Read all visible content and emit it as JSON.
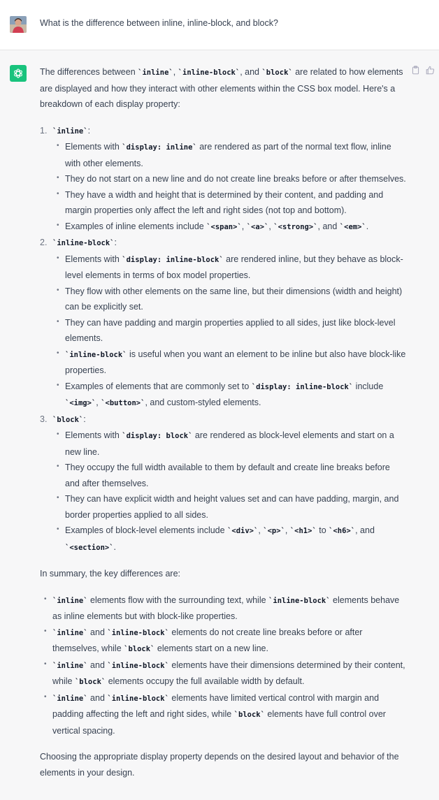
{
  "conversation": {
    "user_message": "What is the difference between inline, inline-block, and block?",
    "assistant": {
      "intro": [
        {
          "t": "The differences between "
        },
        {
          "c": "`inline`"
        },
        {
          "t": ", "
        },
        {
          "c": "`inline-block`"
        },
        {
          "t": ", and "
        },
        {
          "c": "`block`"
        },
        {
          "t": " are related to how elements are displayed and how they interact with other elements within the CSS box model. Here's a breakdown of each display property:"
        }
      ],
      "sections": [
        {
          "num": "1.",
          "heading": "`inline`",
          "heading_suffix": ":",
          "bullets": [
            [
              {
                "t": "Elements with "
              },
              {
                "c": "`display: inline`"
              },
              {
                "t": " are rendered as part of the normal text flow, inline with other elements."
              }
            ],
            [
              {
                "t": "They do not start on a new line and do not create line breaks before or after themselves."
              }
            ],
            [
              {
                "t": "They have a width and height that is determined by their content, and padding and margin properties only affect the left and right sides (not top and bottom)."
              }
            ],
            [
              {
                "t": "Examples of inline elements include "
              },
              {
                "c": "`<span>`"
              },
              {
                "t": ", "
              },
              {
                "c": "`<a>`"
              },
              {
                "t": ", "
              },
              {
                "c": "`<strong>`"
              },
              {
                "t": ", and "
              },
              {
                "c": "`<em>`"
              },
              {
                "t": "."
              }
            ]
          ]
        },
        {
          "num": "2.",
          "heading": "`inline-block`",
          "heading_suffix": ":",
          "bullets": [
            [
              {
                "t": "Elements with "
              },
              {
                "c": "`display: inline-block`"
              },
              {
                "t": " are rendered inline, but they behave as block-level elements in terms of box model properties."
              }
            ],
            [
              {
                "t": "They flow with other elements on the same line, but their dimensions (width and height) can be explicitly set."
              }
            ],
            [
              {
                "t": "They can have padding and margin properties applied to all sides, just like block-level elements."
              }
            ],
            [
              {
                "c": "`inline-block`"
              },
              {
                "t": " is useful when you want an element to be inline but also have block-like properties."
              }
            ],
            [
              {
                "t": "Examples of elements that are commonly set to "
              },
              {
                "c": "`display: inline-block`"
              },
              {
                "t": " include "
              },
              {
                "c": "`<img>`"
              },
              {
                "t": ", "
              },
              {
                "c": "`<button>`"
              },
              {
                "t": ", and custom-styled elements."
              }
            ]
          ]
        },
        {
          "num": "3.",
          "heading": "`block`",
          "heading_suffix": ":",
          "bullets": [
            [
              {
                "t": "Elements with "
              },
              {
                "c": "`display: block`"
              },
              {
                "t": " are rendered as block-level elements and start on a new line."
              }
            ],
            [
              {
                "t": "They occupy the full width available to them by default and create line breaks before and after themselves."
              }
            ],
            [
              {
                "t": "They can have explicit width and height values set and can have padding, margin, and border properties applied to all sides."
              }
            ],
            [
              {
                "t": "Examples of block-level elements include "
              },
              {
                "c": "`<div>`"
              },
              {
                "t": ", "
              },
              {
                "c": "`<p>`"
              },
              {
                "t": ", "
              },
              {
                "c": "`<h1>`"
              },
              {
                "t": " to "
              },
              {
                "c": "`<h6>`"
              },
              {
                "t": ", and "
              },
              {
                "c": "`<section>`"
              },
              {
                "t": "."
              }
            ]
          ]
        }
      ],
      "summary_intro": "In summary, the key differences are:",
      "summary_bullets": [
        [
          {
            "c": "`inline`"
          },
          {
            "t": " elements flow with the surrounding text, while "
          },
          {
            "c": "`inline-block`"
          },
          {
            "t": " elements behave as inline elements but with block-like properties."
          }
        ],
        [
          {
            "c": "`inline`"
          },
          {
            "t": " and "
          },
          {
            "c": "`inline-block`"
          },
          {
            "t": " elements do not create line breaks before or after themselves, while "
          },
          {
            "c": "`block`"
          },
          {
            "t": " elements start on a new line."
          }
        ],
        [
          {
            "c": "`inline`"
          },
          {
            "t": " and "
          },
          {
            "c": "`inline-block`"
          },
          {
            "t": " elements have their dimensions determined by their content, while "
          },
          {
            "c": "`block`"
          },
          {
            "t": " elements occupy the full available width by default."
          }
        ],
        [
          {
            "c": "`inline`"
          },
          {
            "t": " and "
          },
          {
            "c": "`inline-block`"
          },
          {
            "t": " elements have limited vertical control with margin and padding affecting the left and right sides, while "
          },
          {
            "c": "`block`"
          },
          {
            "t": " elements have full control over vertical spacing."
          }
        ]
      ],
      "conclusion": "Choosing the appropriate display property depends on the desired layout and behavior of the elements in your design."
    }
  },
  "icons": {
    "user_avatar": "user-avatar-photo",
    "assistant_avatar": "openai-logo-icon",
    "copy": "clipboard-icon",
    "thumbs_up": "thumbs-up-icon"
  },
  "colors": {
    "assistant_bg": "#f7f7f8",
    "user_bg": "#ffffff",
    "brand_green": "#19c37d",
    "text": "#374151"
  }
}
